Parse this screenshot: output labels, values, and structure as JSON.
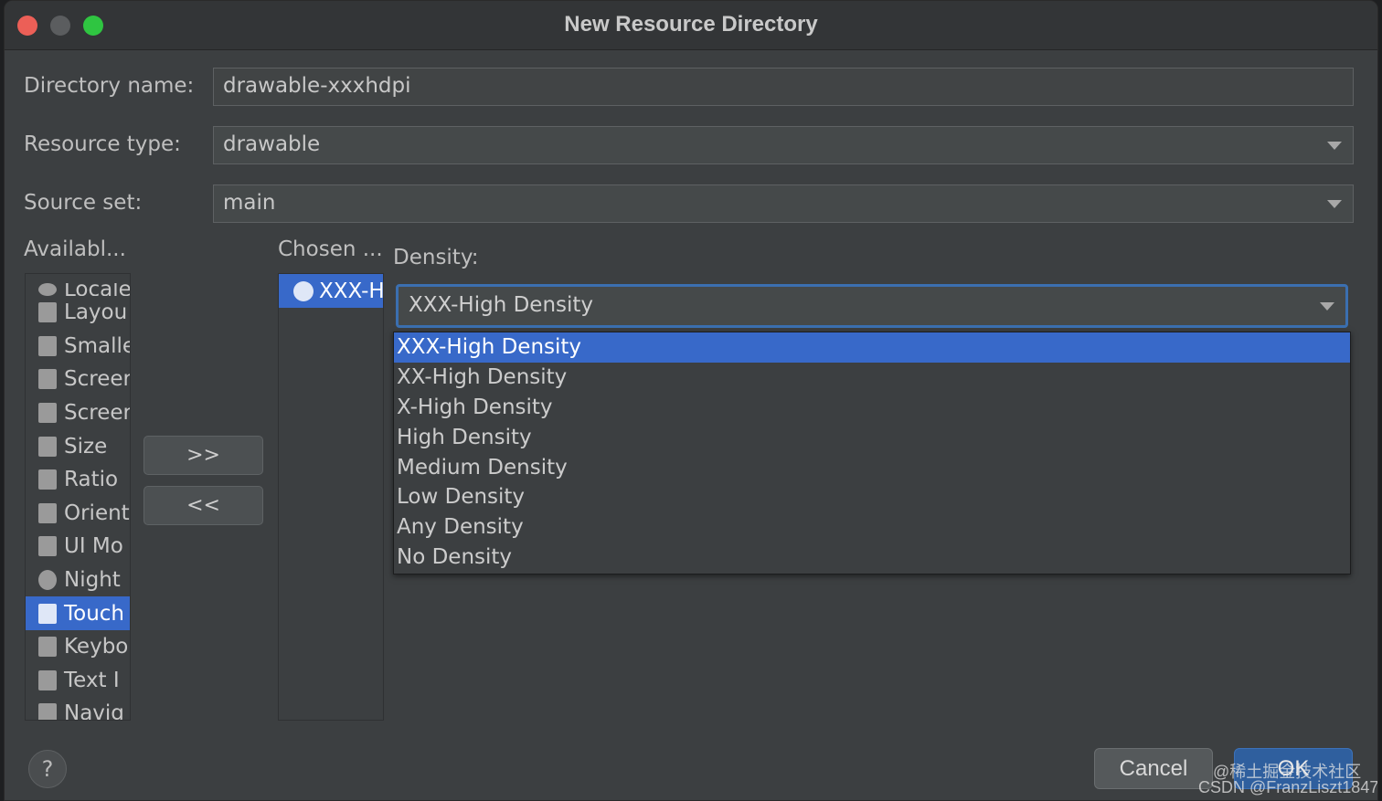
{
  "window": {
    "title": "New Resource Directory"
  },
  "form": {
    "directory_name_label": "Directory name:",
    "directory_name_value": "drawable-xxxhdpi",
    "resource_type_label": "Resource type:",
    "resource_type_value": "drawable",
    "source_set_label": "Source set:",
    "source_set_value": "main"
  },
  "available": {
    "header": "Availabl...",
    "items": [
      {
        "label": "Locale",
        "icon": "locale-icon"
      },
      {
        "label": "Layou",
        "icon": "layout-direction-icon"
      },
      {
        "label": "Smalle",
        "icon": "smallest-width-icon"
      },
      {
        "label": "Screer",
        "icon": "screen-width-icon"
      },
      {
        "label": "Screer",
        "icon": "screen-height-icon"
      },
      {
        "label": "Size",
        "icon": "size-icon"
      },
      {
        "label": "Ratio",
        "icon": "ratio-icon"
      },
      {
        "label": "Orient",
        "icon": "orientation-icon"
      },
      {
        "label": "UI Mo",
        "icon": "ui-mode-icon"
      },
      {
        "label": "Night",
        "icon": "night-mode-icon"
      },
      {
        "label": "Touch",
        "icon": "touch-icon",
        "selected": true
      },
      {
        "label": "Keybo",
        "icon": "keyboard-icon"
      },
      {
        "label": "Text I",
        "icon": "text-input-icon"
      },
      {
        "label": "Navig",
        "icon": "navigation-icon"
      }
    ]
  },
  "buttons": {
    "add": ">>",
    "remove": "<<",
    "help": "?",
    "cancel": "Cancel",
    "ok": "OK"
  },
  "chosen": {
    "header": "Chosen ...",
    "items": [
      {
        "label": "XXX-H",
        "icon": "density-icon"
      }
    ]
  },
  "density": {
    "label": "Density:",
    "selected": "XXX-High Density",
    "options": [
      "XXX-High Density",
      "XX-High Density",
      "X-High Density",
      "High Density",
      "Medium Density",
      "Low Density",
      "Any Density",
      "No Density"
    ]
  },
  "watermark": {
    "line1": "@稀土掘金技术社区",
    "line2": "CSDN @FranzLiszt1847"
  },
  "colors": {
    "accent": "#3869c9",
    "background": "#3c3f41",
    "close": "#ec5f57",
    "maximize": "#2fc541"
  }
}
